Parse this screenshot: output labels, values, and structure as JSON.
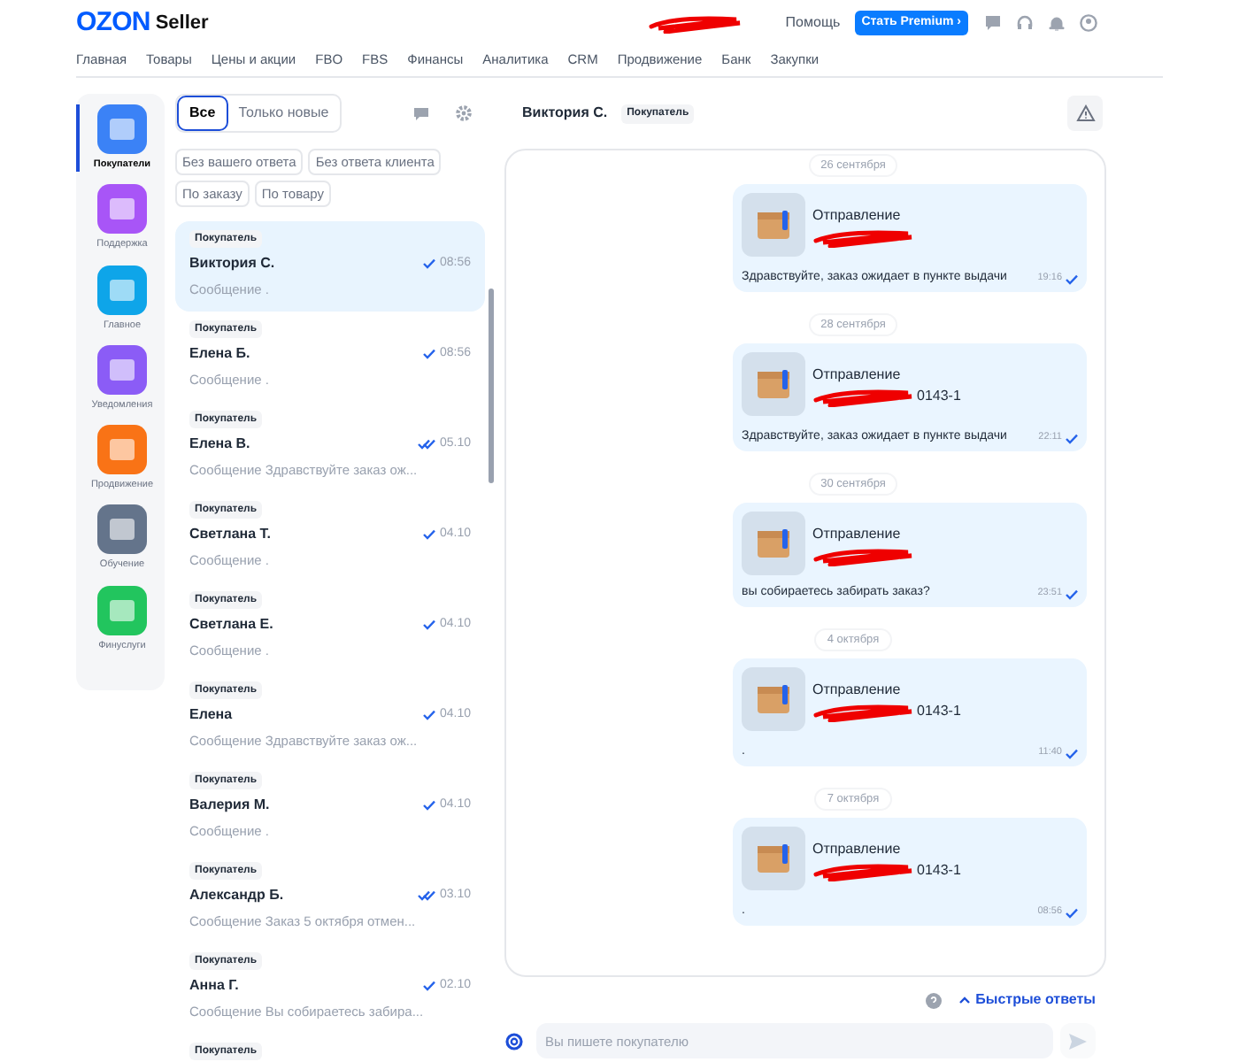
{
  "header": {
    "logo": "OZON",
    "logo_suffix": "Seller",
    "help": "Помощь",
    "premium_button": "Стать Premium ›"
  },
  "nav": [
    "Главная",
    "Товары",
    "Цены и акции",
    "FBO",
    "FBS",
    "Финансы",
    "Аналитика",
    "CRM",
    "Продвижение",
    "Банк",
    "Закупки"
  ],
  "rail": [
    {
      "label": "Покупатели",
      "selected": true,
      "color": "#3b82f6"
    },
    {
      "label": "Поддержка",
      "selected": false,
      "color": "#a855f7"
    },
    {
      "label": "Главное",
      "selected": false,
      "color": "#0ea5e9"
    },
    {
      "label": "Уведомления",
      "selected": false,
      "color": "#8b5cf6"
    },
    {
      "label": "Продвижение",
      "selected": false,
      "color": "#f97316"
    },
    {
      "label": "Обучение",
      "selected": false,
      "color": "#64748b"
    },
    {
      "label": "Финуслуги",
      "selected": false,
      "color": "#22c55e"
    }
  ],
  "tabs": [
    {
      "label": "Все",
      "selected": true
    },
    {
      "label": "Только новые",
      "selected": false
    }
  ],
  "filters": [
    "Без вашего ответа",
    "Без ответа клиента",
    "По заказу",
    "По товару"
  ],
  "chats": [
    {
      "badge": "Покупатель",
      "name": "Виктория С.",
      "time": "08:56",
      "double_check": false,
      "preview": "Сообщение .",
      "selected": true
    },
    {
      "badge": "Покупатель",
      "name": "Елена Б.",
      "time": "08:56",
      "double_check": false,
      "preview": "Сообщение .",
      "selected": false
    },
    {
      "badge": "Покупатель",
      "name": "Елена В.",
      "time": "05.10",
      "double_check": true,
      "preview": "Сообщение Здравствуйте заказ ож...",
      "selected": false
    },
    {
      "badge": "Покупатель",
      "name": "Светлана Т.",
      "time": "04.10",
      "double_check": false,
      "preview": "Сообщение .",
      "selected": false
    },
    {
      "badge": "Покупатель",
      "name": "Светлана Е.",
      "time": "04.10",
      "double_check": false,
      "preview": "Сообщение .",
      "selected": false
    },
    {
      "badge": "Покупатель",
      "name": "Елена",
      "time": "04.10",
      "double_check": false,
      "preview": "Сообщение Здравствуйте заказ ож...",
      "selected": false
    },
    {
      "badge": "Покупатель",
      "name": "Валерия М.",
      "time": "04.10",
      "double_check": false,
      "preview": "Сообщение .",
      "selected": false
    },
    {
      "badge": "Покупатель",
      "name": "Александр Б.",
      "time": "03.10",
      "double_check": true,
      "preview": "Сообщение Заказ 5 октября отмен...",
      "selected": false
    },
    {
      "badge": "Покупатель",
      "name": "Анна Г.",
      "time": "02.10",
      "double_check": false,
      "preview": "Сообщение Вы собираетесь забира...",
      "selected": false
    },
    {
      "badge": "Покупатель",
      "selected": false
    }
  ],
  "conversation": {
    "name": "Виктория С.",
    "badge": "Покупатель",
    "messages": [
      {
        "date": "26 сентября",
        "title": "Отправление",
        "text": "Здравствуйте, заказ ожидает в пункте выдачи",
        "time": "19:16"
      },
      {
        "date": "28 сентября",
        "title": "Отправление",
        "number_tail": "0143-1",
        "text": "Здравствуйте, заказ ожидает в пункте выдачи",
        "time": "22:11"
      },
      {
        "date": "30 сентября",
        "title": "Отправление",
        "text": "вы собираетесь забирать заказ?",
        "time": "23:51"
      },
      {
        "date": "4 октября",
        "title": "Отправление",
        "number_tail": "0143-1",
        "text": ".",
        "time": "11:40"
      },
      {
        "date": "7 октября",
        "title": "Отправление",
        "number_tail": "0143-1",
        "text": ".",
        "time": "08:56"
      }
    ]
  },
  "quick_replies": "Быстрые ответы",
  "composer": {
    "placeholder": "Вы пишете покупателю"
  }
}
